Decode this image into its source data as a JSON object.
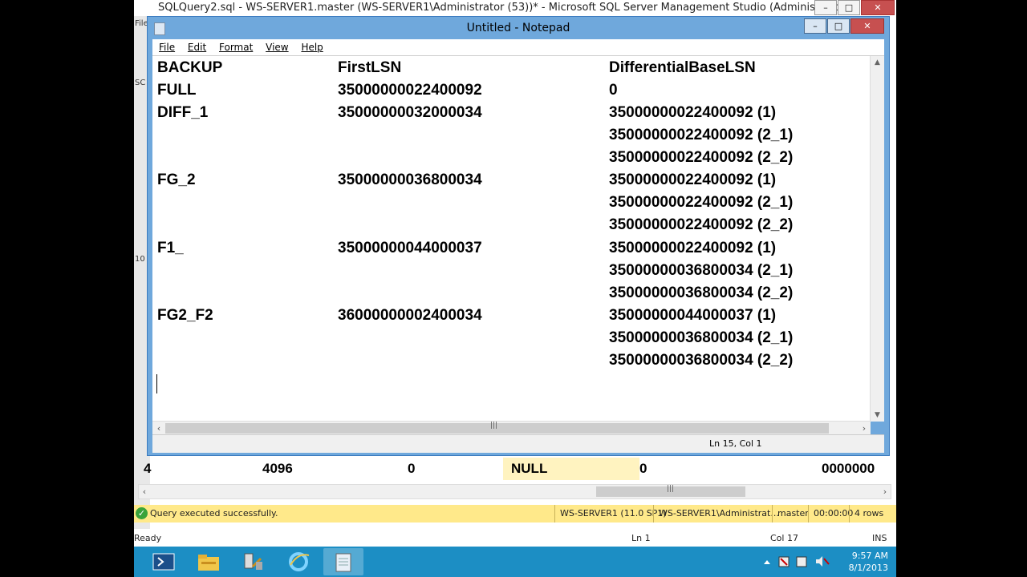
{
  "ssms": {
    "title": "SQLQuery2.sql - WS-SERVER1.master (WS-SERVER1\\Administrator (53))* - Microsoft SQL Server Management Studio (Administrator)",
    "min": "–",
    "max": "□",
    "close": "✕",
    "left_fragments": [
      "File",
      "SC",
      "10"
    ]
  },
  "notepad": {
    "title": "Untitled - Notepad",
    "menu": [
      "File",
      "Edit",
      "Format",
      "View",
      "Help"
    ],
    "headers": {
      "backup": "BACKUP",
      "first_lsn": "FirstLSN",
      "diff_base": "DifferentialBaseLSN"
    },
    "rows": [
      {
        "backup": "FULL",
        "first_lsn": "35000000022400092",
        "diff": [
          "0"
        ]
      },
      {
        "backup": "DIFF_1",
        "first_lsn": "35000000032000034",
        "diff": [
          "35000000022400092 (1)",
          "35000000022400092 (2_1)",
          "35000000022400092 (2_2)"
        ]
      },
      {
        "backup": "FG_2",
        "first_lsn": "35000000036800034",
        "diff": [
          "35000000022400092 (1)",
          "35000000022400092 (2_1)",
          "35000000022400092 (2_2)"
        ]
      },
      {
        "backup": "F1_",
        "first_lsn": "35000000044000037",
        "diff": [
          "35000000022400092 (1)",
          "35000000036800034 (2_1)",
          "35000000036800034 (2_2)"
        ]
      },
      {
        "backup": "FG2_F2",
        "first_lsn": "36000000002400034",
        "diff": [
          "35000000044000037 (1)",
          "35000000036800034 (2_1)",
          "35000000036800034 (2_2)"
        ]
      }
    ],
    "status": "Ln 15, Col 1"
  },
  "grid": {
    "cells": [
      "4",
      "4096",
      "0",
      "NULL",
      "0",
      "0000000"
    ]
  },
  "query_status": {
    "message": "Query executed successfully.",
    "server": "WS-SERVER1 (11.0 SP1)",
    "user": "WS-SERVER1\\Administrat...",
    "database": "master",
    "elapsed": "00:00:00",
    "rows": "4 rows"
  },
  "ssms_status": {
    "ready": "Ready",
    "ln": "Ln 1",
    "col": "Col 17",
    "mode": "INS"
  },
  "clock": {
    "time": "9:57 AM",
    "date": "8/1/2013"
  }
}
